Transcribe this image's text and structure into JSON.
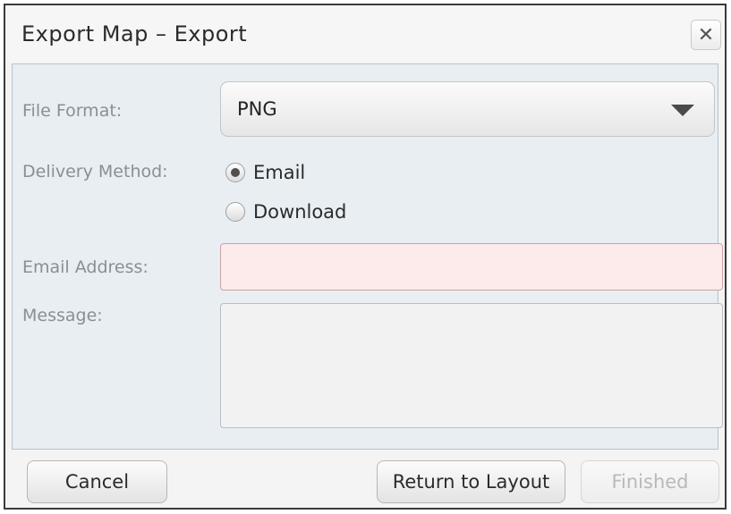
{
  "dialog": {
    "title": "Export Map – Export",
    "close_label": "✕"
  },
  "form": {
    "file_format": {
      "label": "File Format:",
      "selected": "PNG"
    },
    "delivery_method": {
      "label": "Delivery Method:",
      "options": [
        {
          "label": "Email",
          "selected": true
        },
        {
          "label": "Download",
          "selected": false
        }
      ]
    },
    "email_address": {
      "label": "Email Address:",
      "value": "",
      "placeholder": ""
    },
    "message": {
      "label": "Message:",
      "value": "",
      "placeholder": ""
    }
  },
  "footer": {
    "cancel_label": "Cancel",
    "return_label": "Return to Layout",
    "finished_label": "Finished",
    "finished_disabled": true
  },
  "colors": {
    "content_bg": "#e8eef1",
    "invalid_input_bg": "#fdeaea",
    "label_text": "#8a8f94"
  }
}
